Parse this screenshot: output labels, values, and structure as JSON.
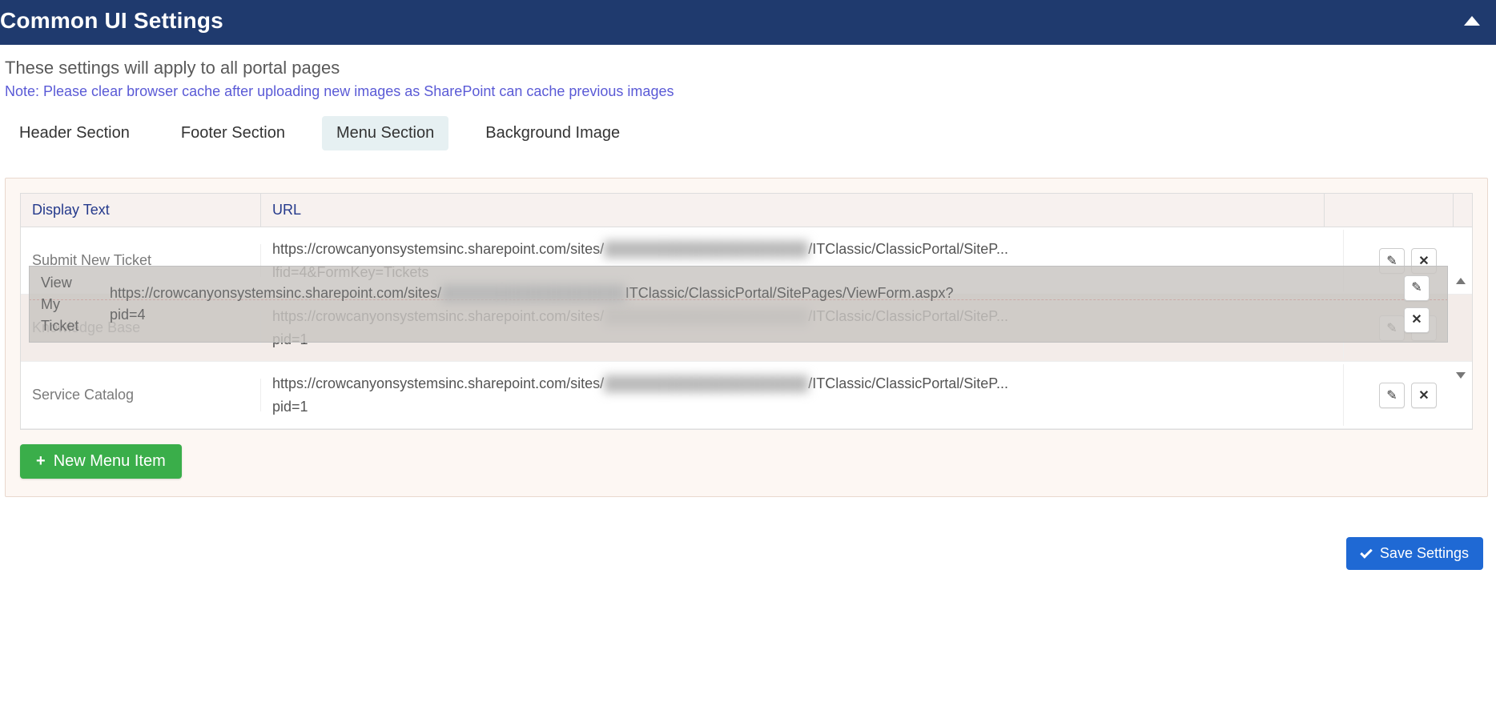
{
  "header": {
    "title": "Common UI Settings"
  },
  "intro": "These settings will apply to all portal pages",
  "note": "Note: Please clear browser cache after uploading new images as SharePoint can cache previous images",
  "tabs": [
    {
      "label": "Header Section",
      "active": false
    },
    {
      "label": "Footer Section",
      "active": false
    },
    {
      "label": "Menu Section",
      "active": true
    },
    {
      "label": "Background Image",
      "active": false
    }
  ],
  "table": {
    "columns": {
      "display_text": "Display Text",
      "url": "URL"
    },
    "rows": [
      {
        "display_text": "Submit New Ticket",
        "url_prefix": "https://crowcanyonsystemsinc.sharepoint.com/sites/",
        "url_redacted": "████████████████████",
        "url_suffix": "/ITClassic/ClassicPortal/SiteP...",
        "url_line2": "lfid=4&FormKey=Tickets"
      },
      {
        "display_text": "Knowledge Base",
        "url_prefix": "https://crowcanyonsystemsinc.sharepoint.com/sites/",
        "url_redacted": "████████████████████",
        "url_suffix": "/ITClassic/ClassicPortal/SiteP...",
        "url_line2": "pid=1"
      },
      {
        "display_text": "Service Catalog",
        "url_prefix": "https://crowcanyonsystemsinc.sharepoint.com/sites/",
        "url_redacted": "████████████████████",
        "url_suffix": "/ITClassic/ClassicPortal/SiteP...",
        "url_line2": "pid=1"
      }
    ],
    "drag_ghost": {
      "display_text_line1": "View",
      "display_text_line2": "My",
      "display_text_line3": "Ticket",
      "url_line1_prefix": "https://crowcanyonsystemsinc.sharepoint.com/sites/",
      "url_line1_redacted": "██████████████████",
      "url_line1_suffix": "ITClassic/ClassicPortal/SitePages/ViewForm.aspx?",
      "url_line2": "pid=4"
    }
  },
  "buttons": {
    "new_menu_item": "New Menu Item",
    "save_settings": "Save Settings"
  }
}
